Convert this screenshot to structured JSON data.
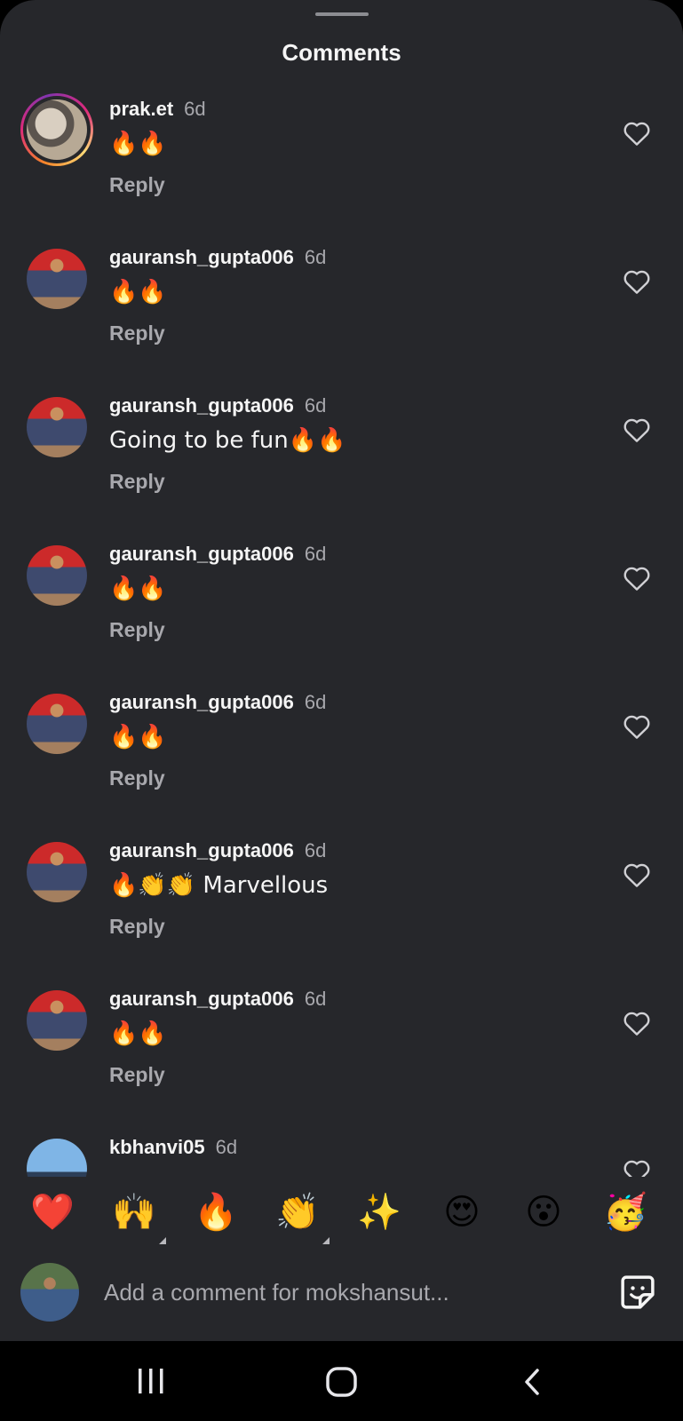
{
  "sheet": {
    "title": "Comments"
  },
  "comments": [
    {
      "username": "prak.et",
      "time": "6d",
      "text": "🔥🔥",
      "reply": "Reply",
      "avatar": "story-ring"
    },
    {
      "username": "gauransh_gupta006",
      "time": "6d",
      "text": "🔥🔥",
      "reply": "Reply"
    },
    {
      "username": "gauransh_gupta006",
      "time": "6d",
      "text": "Going to be fun🔥🔥",
      "reply": "Reply"
    },
    {
      "username": "gauransh_gupta006",
      "time": "6d",
      "text": "🔥🔥",
      "reply": "Reply"
    },
    {
      "username": "gauransh_gupta006",
      "time": "6d",
      "text": "🔥🔥",
      "reply": "Reply"
    },
    {
      "username": "gauransh_gupta006",
      "time": "6d",
      "text": "🔥👏👏 Marvellous",
      "reply": "Reply"
    },
    {
      "username": "gauransh_gupta006",
      "time": "6d",
      "text": "🔥🔥",
      "reply": "Reply"
    },
    {
      "username": "kbhanvi05",
      "time": "6d",
      "text": "",
      "reply": ""
    }
  ],
  "reactions": [
    "❤️",
    "🙌",
    "🔥",
    "👏",
    "✨",
    "😍",
    "😮",
    "🥳"
  ],
  "composer": {
    "placeholder": "Add a comment for mokshansut..."
  },
  "icons": {
    "like": "heart-outline-icon",
    "sticker": "sticker-icon",
    "nav": [
      "recent-apps-icon",
      "home-icon",
      "back-icon"
    ]
  },
  "colors": {
    "background": "#26272b",
    "text": "#f5f5f5",
    "muted": "#a8a8ad",
    "heart_reaction": "#e8242f"
  }
}
